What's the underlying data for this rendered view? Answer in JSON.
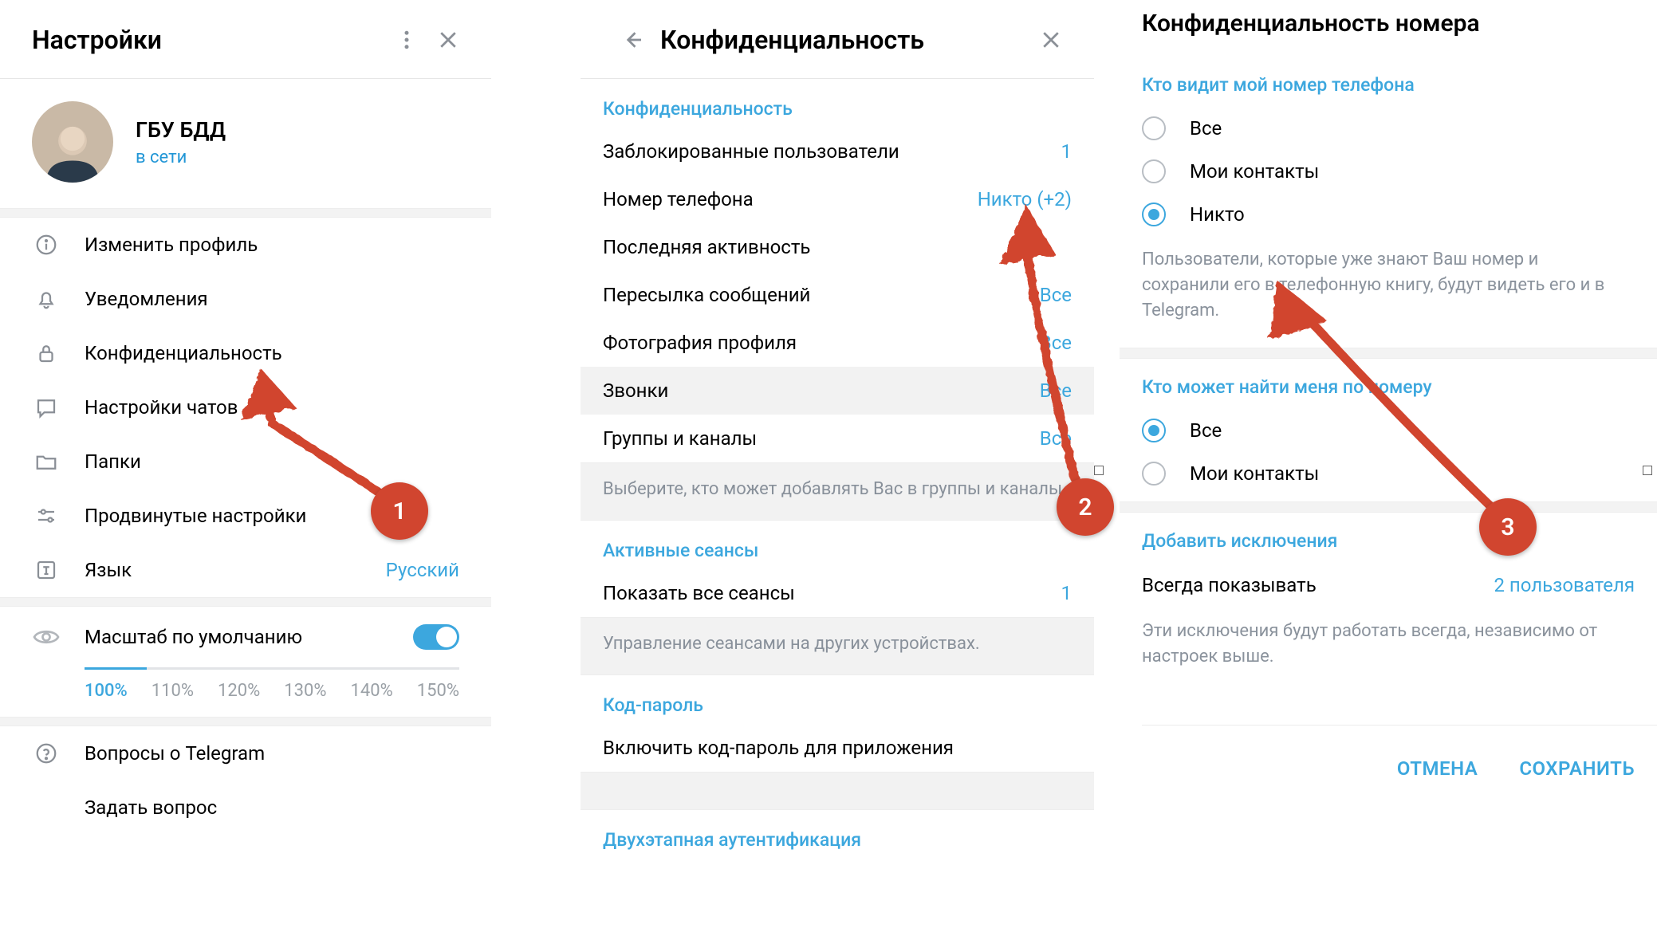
{
  "panel1": {
    "title": "Настройки",
    "profile": {
      "name": "ГБУ БДД",
      "status": "в сети"
    },
    "menu": [
      {
        "id": "edit-profile",
        "label": "Изменить профиль"
      },
      {
        "id": "notifications",
        "label": "Уведомления"
      },
      {
        "id": "privacy",
        "label": "Конфиденциальность"
      },
      {
        "id": "chat-settings",
        "label": "Настройки чатов"
      },
      {
        "id": "folders",
        "label": "Папки"
      },
      {
        "id": "advanced",
        "label": "Продвинутые настройки"
      },
      {
        "id": "language",
        "label": "Язык",
        "value": "Русский"
      }
    ],
    "zoom": {
      "label": "Масштаб по умолчанию",
      "options": [
        "100%",
        "110%",
        "120%",
        "130%",
        "140%",
        "150%"
      ],
      "selected": "100%"
    },
    "footer": [
      {
        "id": "faq",
        "label": "Вопросы о Telegram"
      },
      {
        "id": "ask",
        "label": "Задать вопрос"
      }
    ]
  },
  "panel2": {
    "title": "Конфиденциальность",
    "sections": {
      "privacy": {
        "heading": "Конфиденциальность",
        "rows": [
          {
            "label": "Заблокированные пользователи",
            "value": "1"
          },
          {
            "label": "Номер телефона",
            "value": "Никто (+2)"
          },
          {
            "label": "Последняя активность",
            "value": ""
          },
          {
            "label": "Пересылка сообщений",
            "value": "Все"
          },
          {
            "label": "Фотография профиля",
            "value": "Все"
          },
          {
            "label": "Звонки",
            "value": "Все",
            "hover": true
          },
          {
            "label": "Группы и каналы",
            "value": "Все"
          }
        ],
        "hint": "Выберите, кто может добавлять Вас в группы и каналы."
      },
      "sessions": {
        "heading": "Активные сеансы",
        "rows": [
          {
            "label": "Показать все сеансы",
            "value": "1"
          }
        ],
        "hint": "Управление сеансами на других устройствах."
      },
      "passcode": {
        "heading": "Код-пароль",
        "rows": [
          {
            "label": "Включить код-пароль для приложения",
            "value": ""
          }
        ]
      },
      "twofa": {
        "heading": "Двухэтапная аутентификация"
      }
    }
  },
  "panel3": {
    "title": "Конфиденциальность номера",
    "who_sees": {
      "heading": "Кто видит мой номер телефона",
      "options": [
        {
          "label": "Все",
          "checked": false
        },
        {
          "label": "Мои контакты",
          "checked": false
        },
        {
          "label": "Никто",
          "checked": true
        }
      ],
      "hint": "Пользователи, которые уже знают Ваш номер и сохранили его в телефонную книгу, будут видеть его и в Telegram."
    },
    "who_finds": {
      "heading": "Кто может найти меня по номеру",
      "options": [
        {
          "label": "Все",
          "checked": true
        },
        {
          "label": "Мои контакты",
          "checked": false
        }
      ]
    },
    "exceptions": {
      "heading": "Добавить исключения",
      "row_label": "Всегда показывать",
      "row_value": "2 пользователя",
      "hint": "Эти исключения будут работать всегда, независимо от настроек выше."
    },
    "buttons": {
      "cancel": "ОТМЕНА",
      "save": "СОХРАНИТЬ"
    }
  },
  "annotations": [
    {
      "num": "1"
    },
    {
      "num": "2"
    },
    {
      "num": "3"
    }
  ]
}
